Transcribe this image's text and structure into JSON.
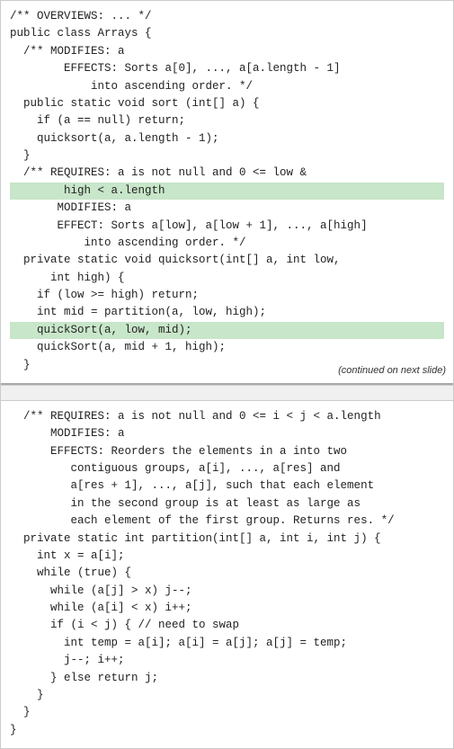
{
  "top_section": {
    "lines": [
      {
        "text": "/** OVERVIEWS: ... */",
        "highlight": false
      },
      {
        "text": "public class Arrays {",
        "highlight": false
      },
      {
        "text": "  /** MODIFIES: a",
        "highlight": false
      },
      {
        "text": "        EFFECTS: Sorts a[0], ..., a[a.length - 1]",
        "highlight": false
      },
      {
        "text": "            into ascending order. */",
        "highlight": false
      },
      {
        "text": "  public static void sort (int[] a) {",
        "highlight": false
      },
      {
        "text": "    if (a == null) return;",
        "highlight": false
      },
      {
        "text": "    quicksort(a, a.length - 1);",
        "highlight": false
      },
      {
        "text": "  }",
        "highlight": false
      },
      {
        "text": "  /** REQUIRES: a is not null and 0 <= low &",
        "highlight": false
      },
      {
        "text": "        high < a.length",
        "highlight": true
      },
      {
        "text": "       MODIFIES: a",
        "highlight": false
      },
      {
        "text": "       EFFECT: Sorts a[low], a[low + 1], ..., a[high]",
        "highlight": false
      },
      {
        "text": "           into ascending order. */",
        "highlight": false
      },
      {
        "text": "  private static void quicksort(int[] a, int low,",
        "highlight": false
      },
      {
        "text": "      int high) {",
        "highlight": false
      },
      {
        "text": "    if (low >= high) return;",
        "highlight": false
      },
      {
        "text": "    int mid = partition(a, low, high);",
        "highlight": false
      },
      {
        "text": "    quickSort(a, low, mid);",
        "highlight": true
      },
      {
        "text": "    quickSort(a, mid + 1, high);",
        "highlight": false
      },
      {
        "text": "  }",
        "highlight": false
      }
    ],
    "continued_label": "(continued on next slide)"
  },
  "bottom_section": {
    "lines": [
      {
        "text": "  /** REQUIRES: a is not null and 0 <= i < j < a.length",
        "highlight": false
      },
      {
        "text": "      MODIFIES: a",
        "highlight": false
      },
      {
        "text": "      EFFECTS: Reorders the elements in a into two",
        "highlight": false
      },
      {
        "text": "         contiguous groups, a[i], ..., a[res] and",
        "highlight": false
      },
      {
        "text": "         a[res + 1], ..., a[j], such that each element",
        "highlight": false
      },
      {
        "text": "         in the second group is at least as large as",
        "highlight": false
      },
      {
        "text": "         each element of the first group. Returns res. */",
        "highlight": false
      },
      {
        "text": "  private static int partition(int[] a, int i, int j) {",
        "highlight": false
      },
      {
        "text": "    int x = a[i];",
        "highlight": false
      },
      {
        "text": "    while (true) {",
        "highlight": false
      },
      {
        "text": "      while (a[j] > x) j--;",
        "highlight": false
      },
      {
        "text": "      while (a[i] < x) i++;",
        "highlight": false
      },
      {
        "text": "      if (i < j) { // need to swap",
        "highlight": false
      },
      {
        "text": "        int temp = a[i]; a[i] = a[j]; a[j] = temp;",
        "highlight": false
      },
      {
        "text": "        j--; i++;",
        "highlight": false
      },
      {
        "text": "      } else return j;",
        "highlight": false
      },
      {
        "text": "    }",
        "highlight": false
      },
      {
        "text": "  }",
        "highlight": false
      },
      {
        "text": "}",
        "highlight": false
      }
    ]
  }
}
